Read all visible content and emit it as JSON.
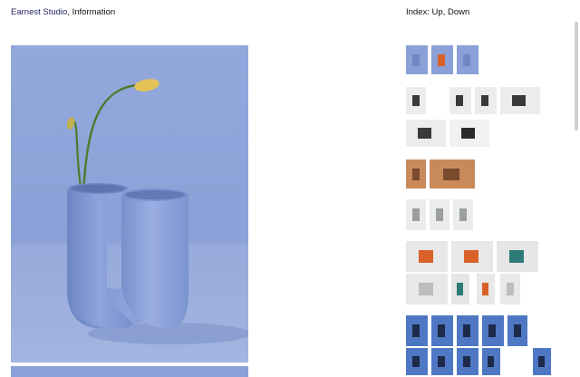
{
  "header": {
    "site_name": "Earnest Studio",
    "separator": ", ",
    "info_link": "Information"
  },
  "index": {
    "label": "Index: ",
    "up": "Up",
    "separator": ", ",
    "down": "Down"
  },
  "colors": {
    "blue_backdrop": "#8aa0d6",
    "vase": "#7f97d1",
    "bud": "#e3c257",
    "stem": "#4f7a2b",
    "orange": "#d9622b",
    "teal": "#2e7a78"
  },
  "thumbnails": [
    {
      "name": "thumb-vase-1",
      "icon": "blue-vase"
    },
    {
      "name": "thumb-vase-2",
      "icon": "blue-vase-orange"
    },
    {
      "name": "thumb-vase-3",
      "icon": "blue-vase"
    },
    {
      "name": "thumb-device-1",
      "icon": "grey-device"
    },
    {
      "name": "thumb-device-2",
      "icon": "grey-device"
    },
    {
      "name": "thumb-device-3",
      "icon": "grey-device"
    },
    {
      "name": "thumb-device-4",
      "icon": "grey-device"
    },
    {
      "name": "thumb-device-5",
      "icon": "grey-device"
    },
    {
      "name": "thumb-bench",
      "icon": "dark-bench"
    },
    {
      "name": "thumb-room-1",
      "icon": "warm-room"
    },
    {
      "name": "thumb-room-2",
      "icon": "warm-room"
    },
    {
      "name": "thumb-switch-1",
      "icon": "wall-switch"
    },
    {
      "name": "thumb-switch-2",
      "icon": "wall-switch"
    },
    {
      "name": "thumb-switch-3",
      "icon": "wall-switch"
    },
    {
      "name": "thumb-tiles-1",
      "icon": "orange-tiles"
    },
    {
      "name": "thumb-tiles-2",
      "icon": "orange-tiles"
    },
    {
      "name": "thumb-tiles-3",
      "icon": "teal-tiles"
    },
    {
      "name": "thumb-tiles-4",
      "icon": "grey-tiles"
    },
    {
      "name": "thumb-tiles-5",
      "icon": "teal-tiles"
    },
    {
      "name": "thumb-tiles-6",
      "icon": "orange-tiles"
    },
    {
      "name": "thumb-tiles-7",
      "icon": "grey-tiles"
    },
    {
      "name": "thumb-lamp-1",
      "icon": "blue-lamp"
    },
    {
      "name": "thumb-lamp-2",
      "icon": "blue-lamp"
    },
    {
      "name": "thumb-lamp-3",
      "icon": "blue-lamp"
    },
    {
      "name": "thumb-lamp-4",
      "icon": "blue-lamp"
    },
    {
      "name": "thumb-lamp-5",
      "icon": "blue-lamp"
    },
    {
      "name": "thumb-lamp-6",
      "icon": "blue-lamp"
    },
    {
      "name": "thumb-lamp-7",
      "icon": "blue-lamp"
    },
    {
      "name": "thumb-lamp-8",
      "icon": "blue-lamp"
    },
    {
      "name": "thumb-lamp-9",
      "icon": "blue-lamp"
    },
    {
      "name": "thumb-lamp-10",
      "icon": "blue-lamp"
    }
  ]
}
